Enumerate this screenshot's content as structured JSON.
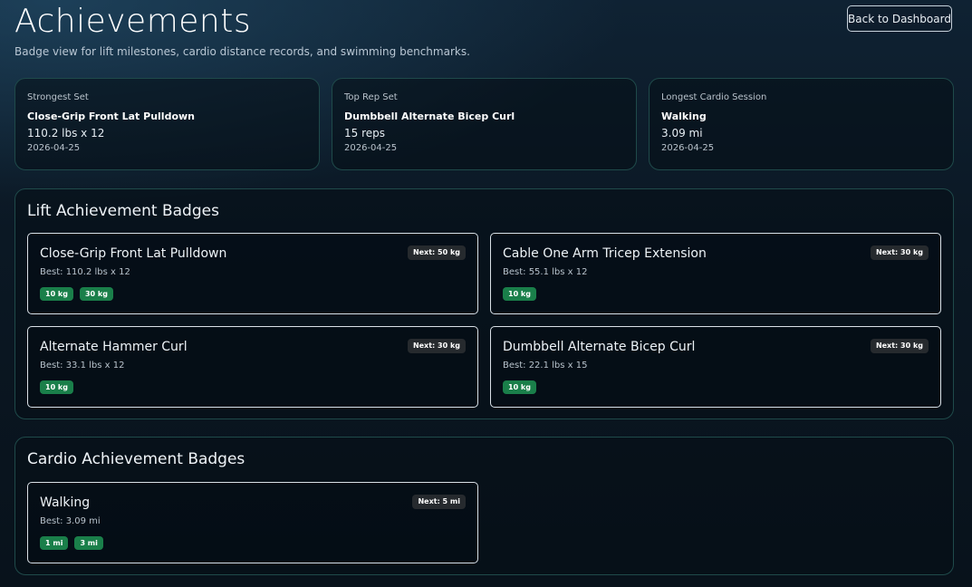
{
  "header": {
    "title": "Achievements",
    "subtitle": "Badge view for lift milestones, cardio distance records, and swimming benchmarks.",
    "back_label": "Back to Dashboard"
  },
  "stats": [
    {
      "label": "Strongest Set",
      "name": "Close-Grip Front Lat Pulldown",
      "value": "110.2 lbs x 12",
      "date": "2026-04-25"
    },
    {
      "label": "Top Rep Set",
      "name": "Dumbbell Alternate Bicep Curl",
      "value": "15 reps",
      "date": "2026-04-25"
    },
    {
      "label": "Longest Cardio Session",
      "name": "Walking",
      "value": "3.09 mi",
      "date": "2026-04-25"
    }
  ],
  "lift_section": {
    "title": "Lift Achievement Badges",
    "cards": [
      {
        "title": "Close-Grip Front Lat Pulldown",
        "best": "Best: 110.2 lbs x 12",
        "next": "Next: 50 kg",
        "badges": [
          "10 kg",
          "30 kg"
        ]
      },
      {
        "title": "Cable One Arm Tricep Extension",
        "best": "Best: 55.1 lbs x 12",
        "next": "Next: 30 kg",
        "badges": [
          "10 kg"
        ]
      },
      {
        "title": "Alternate Hammer Curl",
        "best": "Best: 33.1 lbs x 12",
        "next": "Next: 30 kg",
        "badges": [
          "10 kg"
        ]
      },
      {
        "title": "Dumbbell Alternate Bicep Curl",
        "best": "Best: 22.1 lbs x 15",
        "next": "Next: 30 kg",
        "badges": [
          "10 kg"
        ]
      }
    ]
  },
  "cardio_section": {
    "title": "Cardio Achievement Badges",
    "cards": [
      {
        "title": "Walking",
        "best": "Best: 3.09 mi",
        "next": "Next: 5 mi",
        "badges": [
          "1 mi",
          "3 mi"
        ]
      }
    ]
  },
  "colors": {
    "earned_badge": "#1a7f4a",
    "next_pill": "#262a2e",
    "panel_border": "#1f4a4a"
  }
}
